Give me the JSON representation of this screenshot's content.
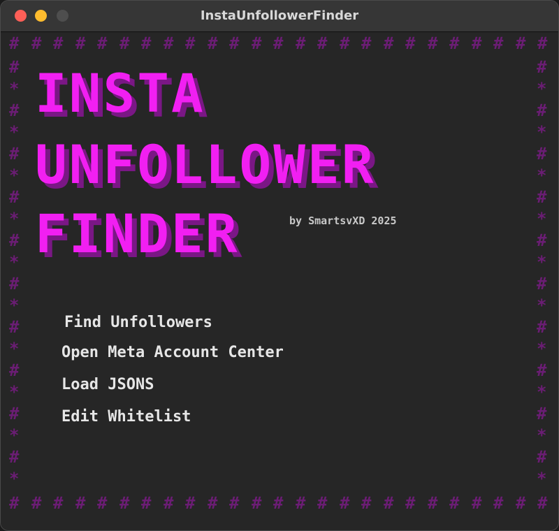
{
  "window": {
    "title": "InstaUnfollowerFinder",
    "traffic_lights": [
      "close",
      "minimize",
      "maximize"
    ]
  },
  "border": {
    "glyph_top_bottom": "#",
    "glyph_left_right_alt": [
      "#",
      "*"
    ],
    "color": "#6b1d74"
  },
  "logo": {
    "lines": [
      "INSTA",
      "UNFOLLOWER",
      "FINDER"
    ],
    "color": "#f11ff2",
    "shadow_color": "#7a1785"
  },
  "byline": "by SmartsvXD 2025",
  "menu": {
    "items": [
      "Find Unfollowers",
      "Open Meta Account Center",
      "Load JSONS",
      "Edit Whitelist"
    ]
  }
}
